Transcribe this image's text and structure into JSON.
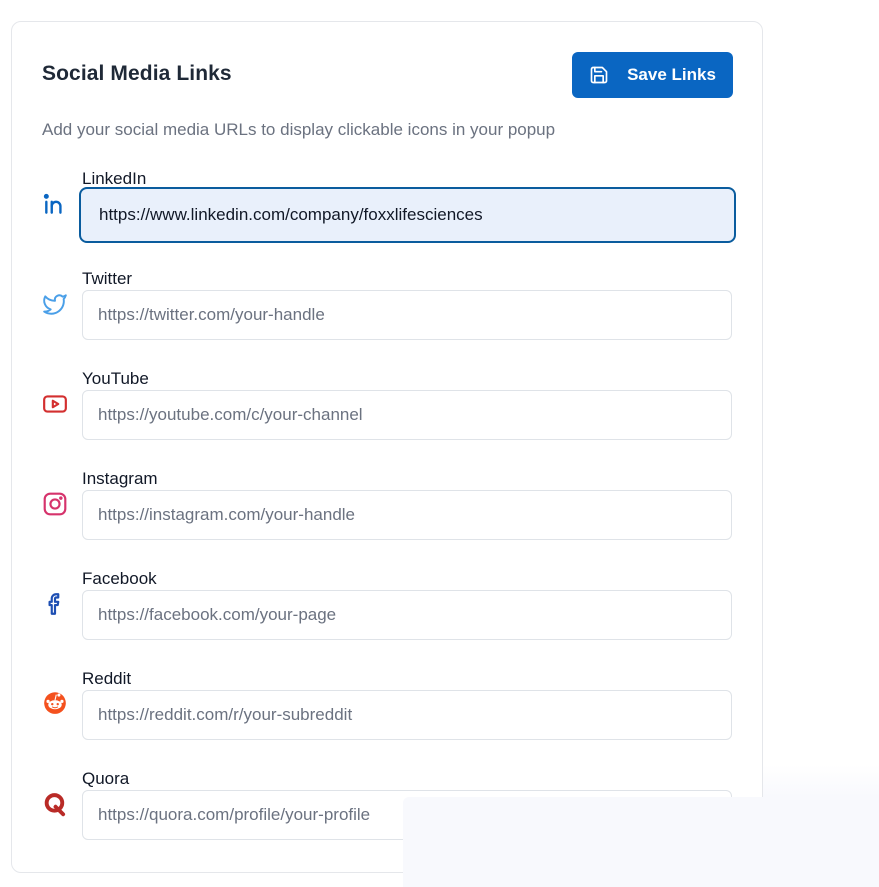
{
  "card": {
    "title": "Social Media Links",
    "save_label": "Save Links",
    "subtitle": "Add your social media URLs to display clickable icons in your popup"
  },
  "fields": [
    {
      "label": "LinkedIn",
      "value": "https://www.linkedin.com/company/foxxlifesciences",
      "placeholder": "",
      "icon": "linkedin-icon",
      "color": "#0a66c2"
    },
    {
      "label": "Twitter",
      "value": "",
      "placeholder": "https://twitter.com/your-handle",
      "icon": "twitter-icon",
      "color": "#4a9fe8"
    },
    {
      "label": "YouTube",
      "value": "",
      "placeholder": "https://youtube.com/c/your-channel",
      "icon": "youtube-icon",
      "color": "#d32f2f"
    },
    {
      "label": "Instagram",
      "value": "",
      "placeholder": "https://instagram.com/your-handle",
      "icon": "instagram-icon",
      "color": "#d6336c"
    },
    {
      "label": "Facebook",
      "value": "",
      "placeholder": "https://facebook.com/your-page",
      "icon": "facebook-icon",
      "color": "#1e4fb3"
    },
    {
      "label": "Reddit",
      "value": "",
      "placeholder": "https://reddit.com/r/your-subreddit",
      "icon": "reddit-icon",
      "color": "#f4511e"
    },
    {
      "label": "Quora",
      "value": "",
      "placeholder": "https://quora.com/profile/your-profile",
      "icon": "quora-icon",
      "color": "#b92b27"
    }
  ],
  "colors": {
    "primary": "#0a66c2",
    "focus_border": "#0a5c9e",
    "focus_bg": "#e9f0fb"
  }
}
